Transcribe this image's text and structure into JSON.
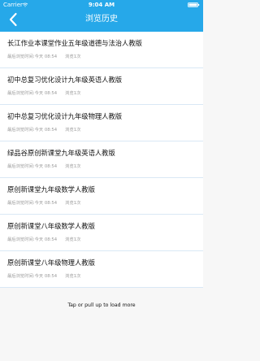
{
  "status_bar": {
    "carrier": "Carrier",
    "time": "9:04 AM"
  },
  "header": {
    "title": "浏览历史"
  },
  "history": [
    {
      "title": "长江作业本课堂作业五年级道德与法治人教版",
      "last_view": "最后浏览时间:今天 08:54",
      "count": "浏览1次"
    },
    {
      "title": "初中总复习优化设计九年级英语人教版",
      "last_view": "最后浏览时间:今天 08:54",
      "count": "浏览1次"
    },
    {
      "title": "初中总复习优化设计九年级物理人教版",
      "last_view": "最后浏览时间:今天 08:54",
      "count": "浏览1次"
    },
    {
      "title": "绿品谷原创新课堂九年级英语人教版",
      "last_view": "最后浏览时间:今天 08:54",
      "count": "浏览1次"
    },
    {
      "title": "原创新课堂九年级数学人教版",
      "last_view": "最后浏览时间:今天 08:54",
      "count": "浏览1次"
    },
    {
      "title": "原创新课堂八年级数学人教版",
      "last_view": "最后浏览时间:今天 08:54",
      "count": "浏览1次"
    },
    {
      "title": "原创新课堂八年级物理人教版",
      "last_view": "最后浏览时间:今天 08:54",
      "count": "浏览1次"
    }
  ],
  "footer": {
    "load_more": "Tap or pull up to load more"
  }
}
